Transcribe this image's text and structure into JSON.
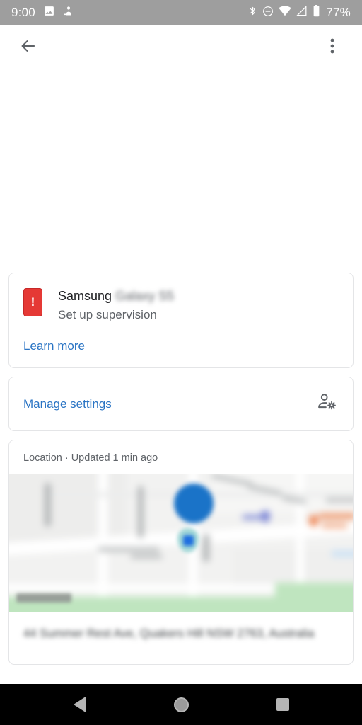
{
  "status_bar": {
    "time": "9:00",
    "battery_percent": "77%",
    "left_icons": [
      "image-icon",
      "app-notification-icon"
    ],
    "right_icons": [
      "bluetooth-icon",
      "do-not-disturb-icon",
      "wifi-icon",
      "cellular-signal-icon",
      "battery-icon"
    ]
  },
  "app_bar": {
    "back_icon": "back-arrow-icon",
    "overflow_icon": "overflow-menu-icon",
    "title": ""
  },
  "device_card": {
    "icon": "phone-alert-icon",
    "brand": "Samsung",
    "model": "Galaxy S5",
    "subtitle": "Set up supervision",
    "learn_more_label": "Learn more"
  },
  "manage_card": {
    "label": "Manage settings",
    "icon": "manage-accounts-icon"
  },
  "location_card": {
    "header": "Location · Updated 1 min ago",
    "map": {
      "watermark": "Google",
      "markers": [
        "child-avatar-marker",
        "location-pin-marker",
        "poi-purple-marker",
        "poi-orange-marker"
      ]
    },
    "address": "44 Summer Rest Ave, Quakers Hill NSW 2763, Australia"
  },
  "nav_bar": {
    "back_label": "Back",
    "home_label": "Home",
    "recents_label": "Recents"
  },
  "colors": {
    "status_bar_bg": "#9e9e9e",
    "link_blue": "#2a74c4",
    "alert_red": "#e53935",
    "body_text": "#202124",
    "secondary_text": "#5f6368",
    "card_border": "#e4e5e7",
    "nav_bar_bg": "#000000"
  }
}
